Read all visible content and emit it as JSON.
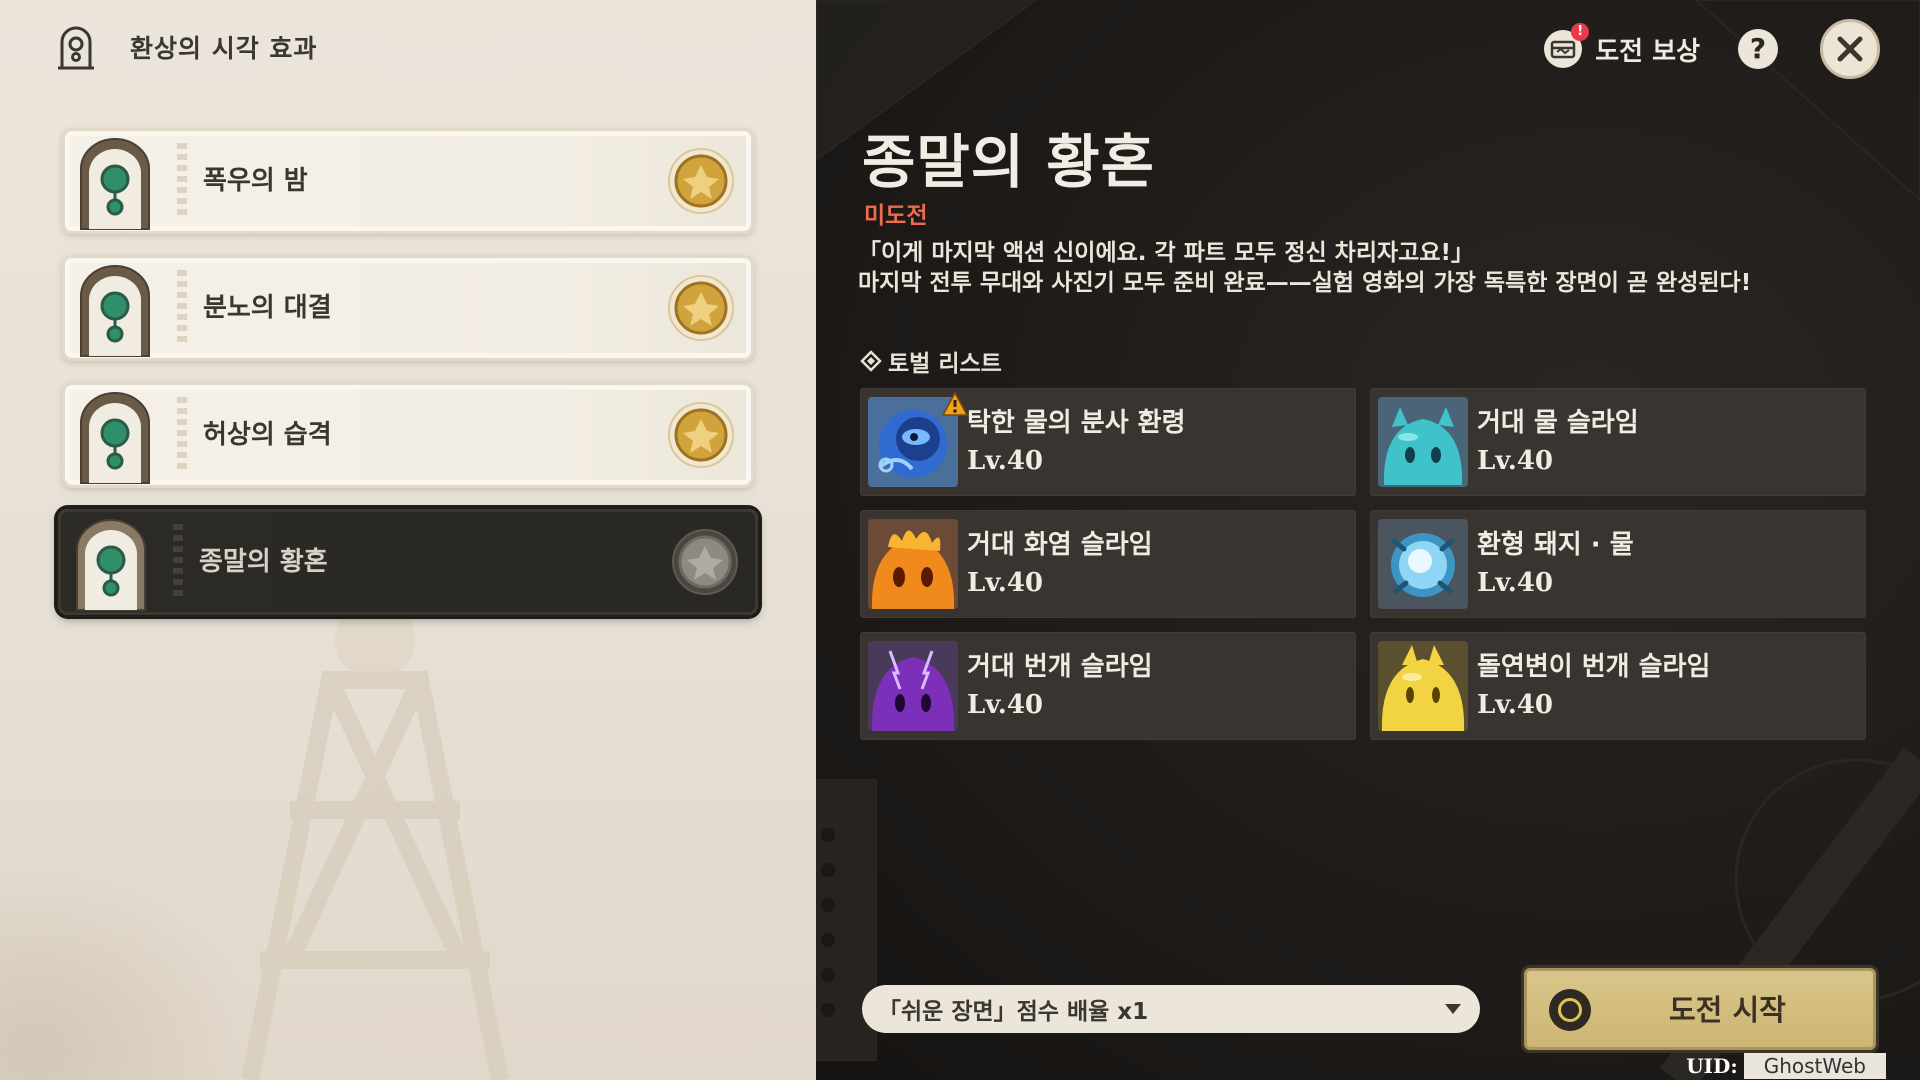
{
  "left": {
    "title": "환상의 시각 효과",
    "stages": [
      {
        "label": "폭우의 밤",
        "selected": false
      },
      {
        "label": "분노의 대결",
        "selected": false
      },
      {
        "label": "허상의 습격",
        "selected": false
      },
      {
        "label": "종말의 황혼",
        "selected": true
      }
    ]
  },
  "top_bar": {
    "reward_label": "도전 보상",
    "reward_badge": "!",
    "help_label": "?"
  },
  "detail": {
    "title": "종말의 황혼",
    "status": "미도전",
    "description_line1": "「이게 마지막 액션 신이에요. 각 파트 모두 정신 차리자고요!」",
    "description_line2": "마지막 전투 무대와 사진기 모두 준비 완료——실험 영화의 가장 독특한 장면이 곧 완성된다!",
    "section_title": "토벌 리스트",
    "enemies": [
      {
        "name": "탁한 물의 분사 환령",
        "level": "Lv.40",
        "icon": "hydro-specter-icon",
        "warning": true
      },
      {
        "name": "거대 물 슬라임",
        "level": "Lv.40",
        "icon": "hydro-slime-icon",
        "warning": false
      },
      {
        "name": "거대 화염 슬라임",
        "level": "Lv.40",
        "icon": "pyro-slime-icon",
        "warning": false
      },
      {
        "name": "환형 돼지 · 물",
        "level": "Lv.40",
        "icon": "hydro-boar-icon",
        "warning": false
      },
      {
        "name": "거대 번개 슬라임",
        "level": "Lv.40",
        "icon": "electro-slime-icon",
        "warning": false
      },
      {
        "name": "돌연변이 번개 슬라임",
        "level": "Lv.40",
        "icon": "mutant-electro-slime-icon",
        "warning": false
      }
    ],
    "difficulty": "「쉬운 장면」점수 배율 x1",
    "start_label": "도전 시작"
  },
  "uid": {
    "label": "UID:",
    "value": "GhostWeb"
  },
  "colors": {
    "accent_gold": "#cdb673",
    "status_red": "#f06a4f",
    "panel_dark": "#1d1a18",
    "panel_light": "#ebe5dc"
  }
}
